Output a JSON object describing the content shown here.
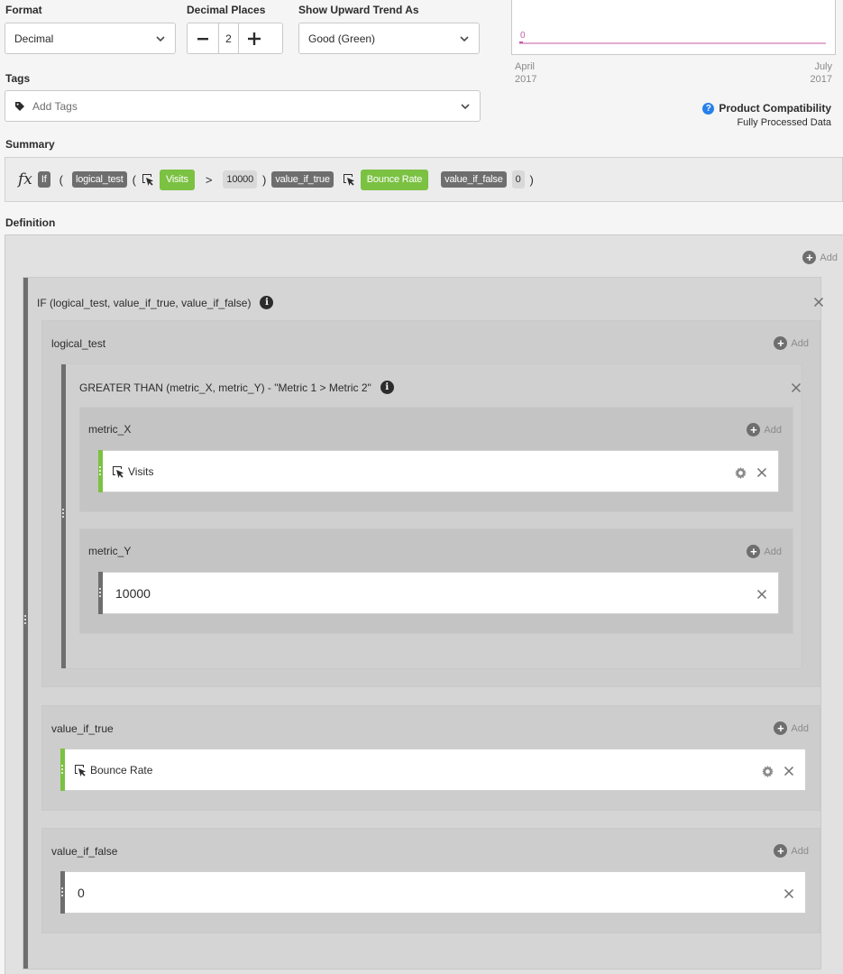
{
  "format": {
    "label": "Format",
    "value": "Decimal"
  },
  "decimal_places": {
    "label": "Decimal Places",
    "value": "2"
  },
  "trend": {
    "label": "Show Upward Trend As",
    "value": "Good (Green)"
  },
  "tags": {
    "label": "Tags",
    "placeholder": "Add Tags"
  },
  "preview": {
    "zero_label": "0",
    "x_start_month": "April",
    "x_start_year": "2017",
    "x_end_month": "July",
    "x_end_year": "2017",
    "line_color": "#c75ba6"
  },
  "compat": {
    "title": "Product Compatibility",
    "subtitle": "Fully Processed Data"
  },
  "summary": {
    "label": "Summary",
    "fx": "fx",
    "if_chip": "If",
    "paren_open": "(",
    "paren_close": ")",
    "logical_test": "logical_test",
    "visits": "Visits",
    "gt": ">",
    "value_10000": "10000",
    "value_if_true": "value_if_true",
    "bounce_rate": "Bounce Rate",
    "value_if_false": "value_if_false",
    "zero": "0"
  },
  "definition": {
    "label": "Definition",
    "add": "Add",
    "if_block": {
      "title": "IF (logical_test, value_if_true, value_if_false)",
      "logical_test": {
        "title": "logical_test",
        "gt_block": {
          "title": "GREATER THAN (metric_X, metric_Y)  -  \"Metric 1 > Metric 2\"",
          "metric_x": {
            "title": "metric_X",
            "item": "Visits"
          },
          "metric_y": {
            "title": "metric_Y",
            "item": "10000"
          }
        }
      },
      "value_if_true": {
        "title": "value_if_true",
        "item": "Bounce Rate"
      },
      "value_if_false": {
        "title": "value_if_false",
        "item": "0"
      }
    }
  },
  "colors": {
    "accent_green": "#7bc142",
    "info_blue": "#2680eb",
    "chip_dark": "#6e6e6e"
  }
}
